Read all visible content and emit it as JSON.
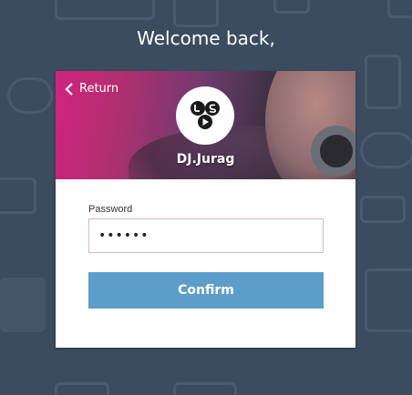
{
  "page": {
    "welcome_text": "Welcome back,"
  },
  "card": {
    "return_label": "Return",
    "username": "DJ.Jurag",
    "avatar_icon": "lsd-logo-icon",
    "password_label": "Password",
    "password_value": "••••••",
    "confirm_label": "Confirm"
  },
  "colors": {
    "background": "#3b4c5f",
    "confirm_button": "#5c9dc9",
    "banner_accent": "#d1237f"
  }
}
